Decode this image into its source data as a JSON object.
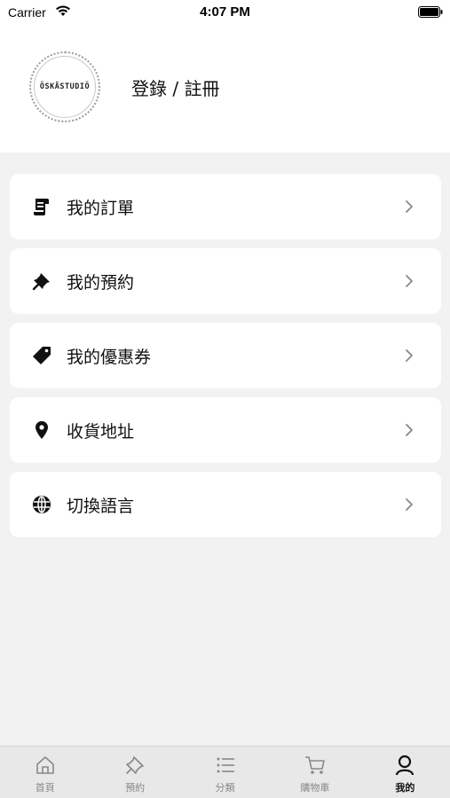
{
  "status_bar": {
    "carrier": "Carrier",
    "time": "4:07 PM"
  },
  "header": {
    "logo_text": "ÖSKÄSTUDIÖ",
    "login_label": "登錄 / 註冊"
  },
  "menu": {
    "items": [
      {
        "label": "我的訂單",
        "icon": "receipt-icon"
      },
      {
        "label": "我的預約",
        "icon": "pushpin-icon"
      },
      {
        "label": "我的優惠券",
        "icon": "tag-icon"
      },
      {
        "label": "收貨地址",
        "icon": "location-pin-icon"
      },
      {
        "label": "切換語言",
        "icon": "globe-icon"
      }
    ]
  },
  "tab_bar": {
    "tabs": [
      {
        "label": "首頁",
        "icon": "home-icon",
        "active": false
      },
      {
        "label": "預約",
        "icon": "pushpin-icon",
        "active": false
      },
      {
        "label": "分類",
        "icon": "list-icon",
        "active": false
      },
      {
        "label": "購物車",
        "icon": "cart-icon",
        "active": false
      },
      {
        "label": "我的",
        "icon": "person-icon",
        "active": true
      }
    ]
  },
  "colors": {
    "background": "#f2f2f2",
    "card": "#ffffff",
    "tab_bar": "#e8e8e8",
    "tab_inactive": "#888888",
    "tab_active": "#111111"
  }
}
